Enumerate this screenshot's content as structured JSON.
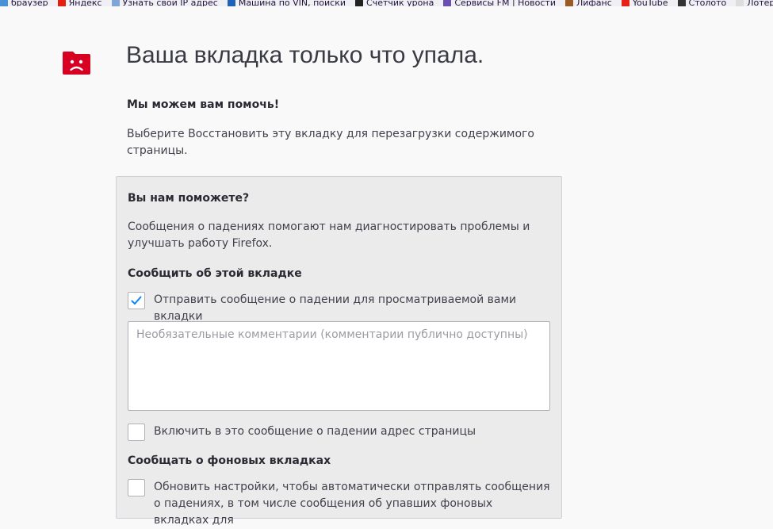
{
  "bookmarks": [
    {
      "label": "браузер",
      "icon": "browser-icon",
      "color": "#4a90d9"
    },
    {
      "label": "Яндекс",
      "icon": "yandex-icon",
      "color": "#e3200f"
    },
    {
      "label": "Узнать свой IP адрес",
      "icon": "ip-icon",
      "color": "#7ea7d8"
    },
    {
      "label": "Машина по VIN, поиски",
      "icon": "car-icon",
      "color": "#1e63b8"
    },
    {
      "label": "Счетчик урона",
      "icon": "counter-icon",
      "color": "#222222"
    },
    {
      "label": "Сервисы FM | Новости",
      "icon": "fm-icon",
      "color": "#6a4fb3"
    },
    {
      "label": "Лифанс",
      "icon": "lifans-icon",
      "color": "#9b5a24"
    },
    {
      "label": "YouTube",
      "icon": "youtube-icon",
      "color": "#e62117"
    },
    {
      "label": "Столото",
      "icon": "stoloto-icon",
      "color": "#333333"
    },
    {
      "label": "Лотерея",
      "icon": "lottery-icon",
      "color": "#dddddd"
    }
  ],
  "crash": {
    "icon": "sad-tab-icon",
    "icon_color": "#d70022",
    "title": "Ваша вкладка только что упала.",
    "subtitle": "Мы можем вам помочь!",
    "intro": "Выберите Восстановить эту вкладку для перезагрузки содержимого страницы."
  },
  "report": {
    "heading": "Вы нам поможете?",
    "description": "Сообщения о падениях помогают нам диагностировать проблемы и улучшать работу Firefox.",
    "section_tab": "Сообщить об этой вкладке",
    "send_report_label": "Отправить сообщение о падении для просматриваемой вами вкладки",
    "send_report_checked": true,
    "comments_placeholder": "Необязательные комментарии (комментарии публично доступны)",
    "include_url_label": "Включить в это сообщение о падении адрес страницы",
    "include_url_checked": false,
    "section_background": "Сообщать о фоновых вкладках",
    "auto_submit_label": "Обновить настройки, чтобы автоматически отправлять сообщения о падениях, в том числе сообщения об упавших фоновых вкладках для",
    "auto_submit_checked": false,
    "accent_color": "#0a84ff"
  }
}
